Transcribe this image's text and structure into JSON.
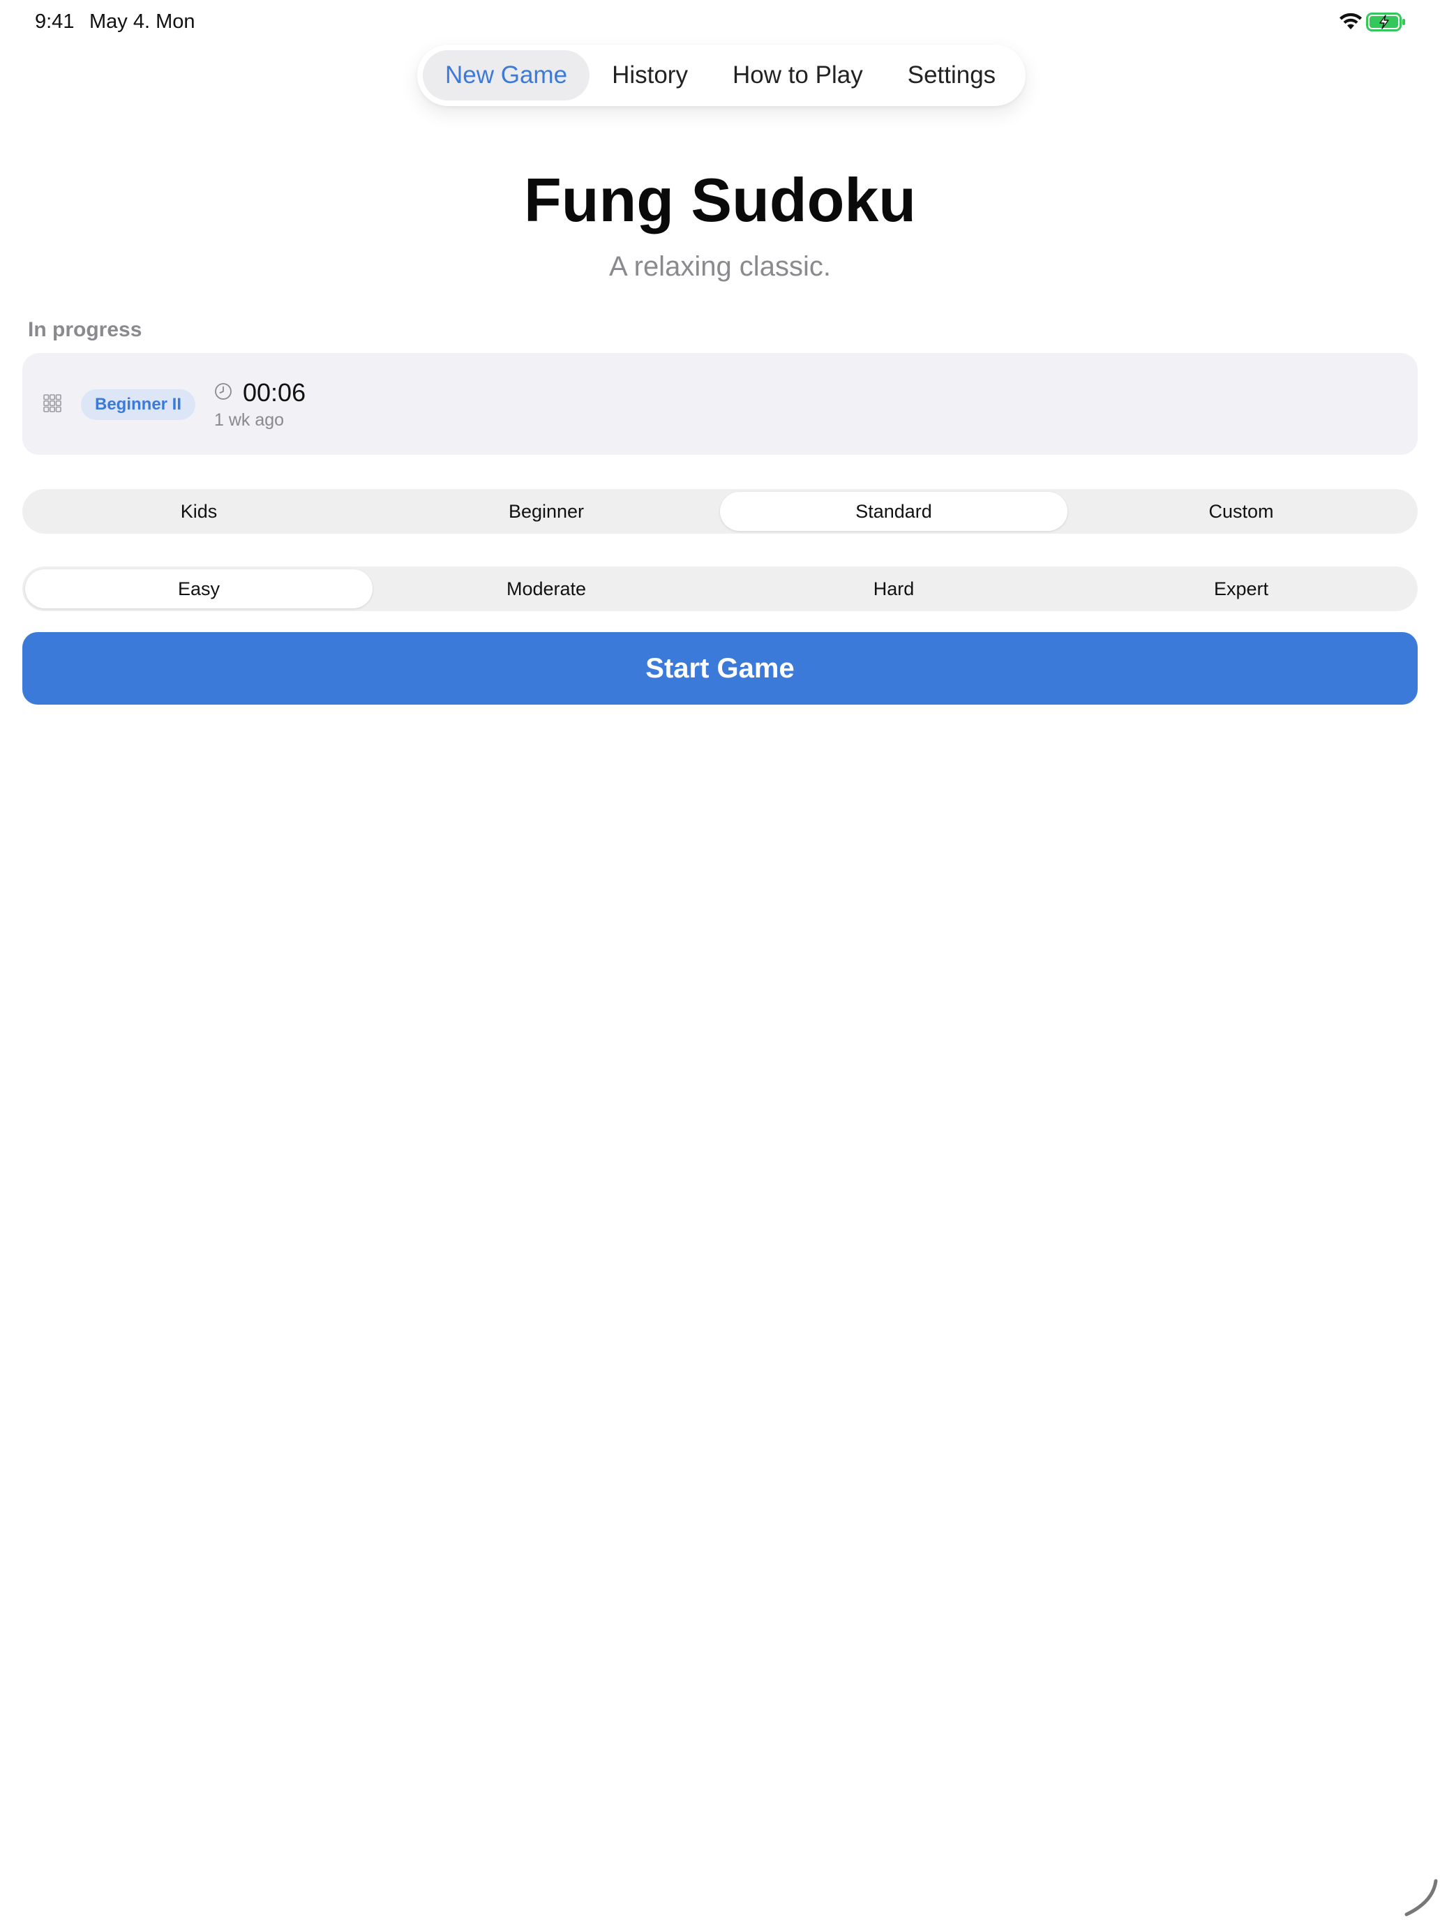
{
  "status_bar": {
    "time": "9:41",
    "date": "May 4. Mon",
    "icons": [
      "wifi-icon",
      "battery-charging-icon"
    ]
  },
  "top_tabs": [
    {
      "label": "New Game",
      "active": true
    },
    {
      "label": "History",
      "active": false
    },
    {
      "label": "How to Play",
      "active": false
    },
    {
      "label": "Settings",
      "active": false
    }
  ],
  "header": {
    "title": "Fung Sudoku",
    "subtitle": "A relaxing classic."
  },
  "in_progress": {
    "section_label": "In progress",
    "game": {
      "icon": "grid-icon",
      "level": "Beginner II",
      "timer_icon": "clock-icon",
      "elapsed": "00:06",
      "last_played": "1 wk ago"
    }
  },
  "mode_selector": {
    "options": [
      "Kids",
      "Beginner",
      "Standard",
      "Custom"
    ],
    "selected": "Standard"
  },
  "difficulty_selector": {
    "options": [
      "Easy",
      "Moderate",
      "Hard",
      "Expert"
    ],
    "selected": "Easy"
  },
  "start_button": {
    "label": "Start Game"
  },
  "colors": {
    "accent": "#3b7ad9",
    "card_background": "#f2f2f6",
    "segment_background": "#efefef",
    "badge_background": "#dce6f7",
    "secondary_text": "#8a8a8e",
    "battery_green": "#34c759"
  }
}
